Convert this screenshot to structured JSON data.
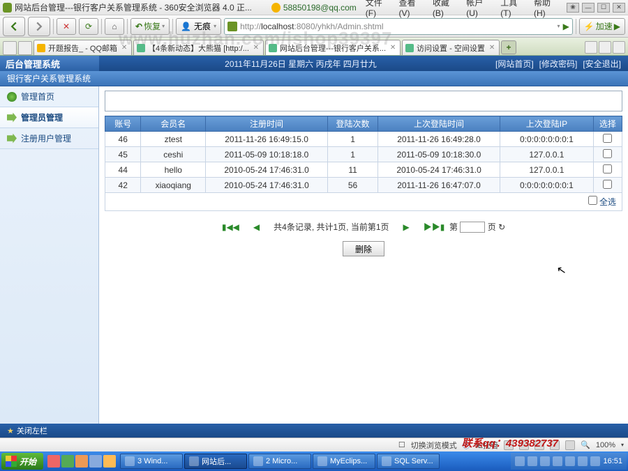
{
  "titlebar": {
    "title": "网站后台管理---银行客户关系管理系统 - 360安全浏览器 4.0 正...",
    "qq": "58850198@qq.com",
    "menus": [
      "文件(F)",
      "查看(V)",
      "收藏(B)",
      "帐户(U)",
      "工具(T)",
      "帮助(H)"
    ]
  },
  "toolbar": {
    "restore": "恢复",
    "notrace": "无痕",
    "url_prefix": "http://",
    "url_host": "localhost",
    "url_rest": ":8080/yhkh/Admin.shtml",
    "speed": "加速"
  },
  "tabs": [
    {
      "label": "开题报告_ - QQ邮箱",
      "active": false
    },
    {
      "label": "【4条新动态】大熊猫 [http:/...",
      "active": false
    },
    {
      "label": "网站后台管理---银行客户关系...",
      "active": true
    },
    {
      "label": "访问设置 - 空间设置",
      "active": false
    }
  ],
  "app": {
    "logo": "后台管理系统",
    "date": "2011年11月26日  星期六  丙戌年  四月廿九",
    "links": [
      "[网站首页]",
      "[修改密码]",
      "[安全退出]"
    ],
    "subtitle": "银行客户关系管理系统"
  },
  "sidebar": {
    "items": [
      {
        "label": "管理首页"
      },
      {
        "label": "管理员管理"
      },
      {
        "label": "注册用户管理"
      }
    ]
  },
  "table": {
    "headers": [
      "账号",
      "会员名",
      "注册时间",
      "登陆次数",
      "上次登陆时间",
      "上次登陆IP",
      "选择"
    ],
    "rows": [
      {
        "id": "46",
        "name": "ztest",
        "reg": "2011-11-26 16:49:15.0",
        "count": "1",
        "last": "2011-11-26 16:49:28.0",
        "ip": "0:0:0:0:0:0:0:1"
      },
      {
        "id": "45",
        "name": "ceshi",
        "reg": "2011-05-09 10:18:18.0",
        "count": "1",
        "last": "2011-05-09 10:18:30.0",
        "ip": "127.0.0.1"
      },
      {
        "id": "44",
        "name": "hello",
        "reg": "2010-05-24 17:46:31.0",
        "count": "11",
        "last": "2010-05-24 17:46:31.0",
        "ip": "127.0.0.1"
      },
      {
        "id": "42",
        "name": "xiaoqiang",
        "reg": "2010-05-24 17:46:31.0",
        "count": "56",
        "last": "2011-11-26 16:47:07.0",
        "ip": "0:0:0:0:0:0:0:1"
      }
    ],
    "selectall": "全选"
  },
  "pager": {
    "summary": "共4条记录, 共计1页, 当前第1页",
    "page_label_prefix": "第",
    "page_label_suffix": "页"
  },
  "buttons": {
    "delete": "删除"
  },
  "appfoot": {
    "collapse": "关闭左栏"
  },
  "statusbar": {
    "switch": "切换浏览模式",
    "ie": "IE托管",
    "items": [
      "下载",
      "用户",
      "弹窗",
      "声音"
    ],
    "zoom": "100%"
  },
  "taskbar": {
    "start": "开始",
    "tasks": [
      {
        "label": "3 Wind..."
      },
      {
        "label": "网站后...",
        "active": true
      },
      {
        "label": "2 Micro..."
      },
      {
        "label": "MyEclips..."
      },
      {
        "label": "SQL Serv..."
      }
    ],
    "clock": "16:51"
  },
  "watermark": "www.huzhan.com/ishop39397",
  "watermark_qq": "联系qq：439382737"
}
